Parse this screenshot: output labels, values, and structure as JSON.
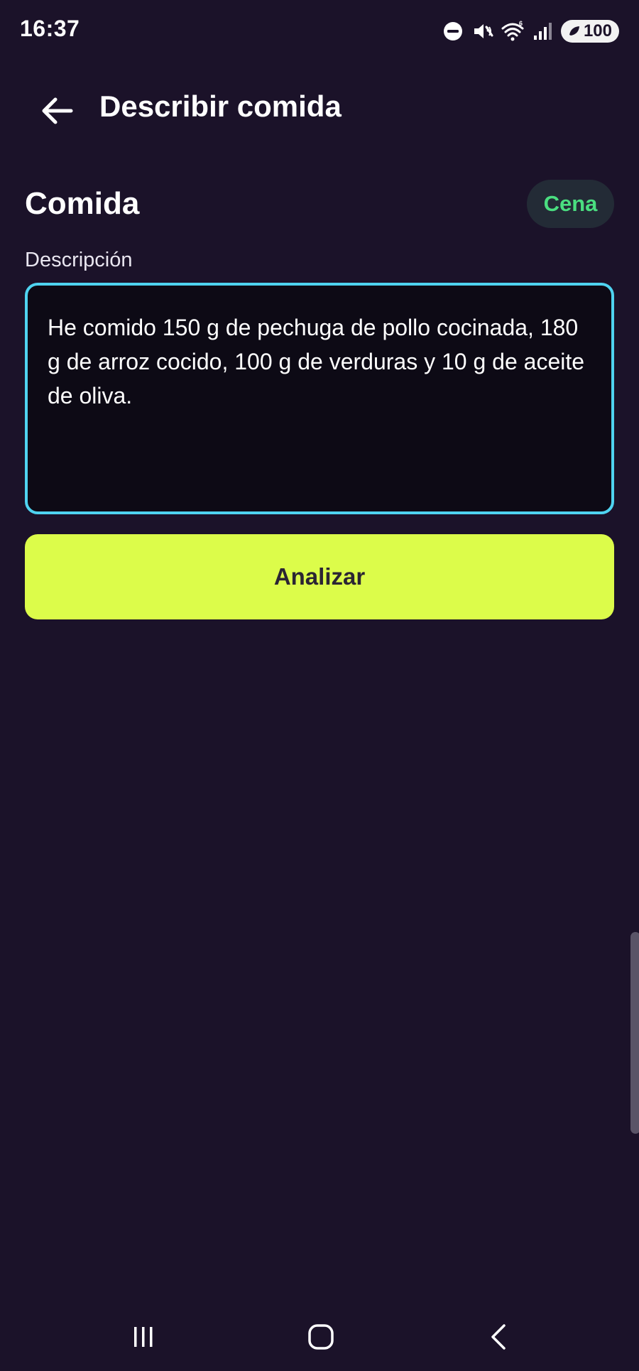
{
  "status_bar": {
    "time": "16:37",
    "battery": "100",
    "wifi_badge": "6"
  },
  "header": {
    "title": "Describir comida"
  },
  "meal": {
    "section_title": "Comida",
    "chip_label": "Cena"
  },
  "description": {
    "label": "Descripción",
    "value": "He comido 150 g de pechuga de pollo cocinada, 180 g de arroz cocido, 100 g de verduras y 10 g de aceite de oliva."
  },
  "actions": {
    "analyze_label": "Analizar"
  },
  "colors": {
    "background": "#1b1229",
    "accent": "#dcfc4a",
    "focus_border": "#4fd3f0",
    "chip_text": "#4ade80"
  },
  "icons": {
    "back": "arrow-left-icon",
    "dnd": "do-not-disturb-icon",
    "mute": "mute-icon",
    "wifi": "wifi-icon",
    "signal": "signal-icon",
    "recents": "recent-apps-icon",
    "home": "home-icon",
    "nav_back": "chevron-left-icon"
  }
}
